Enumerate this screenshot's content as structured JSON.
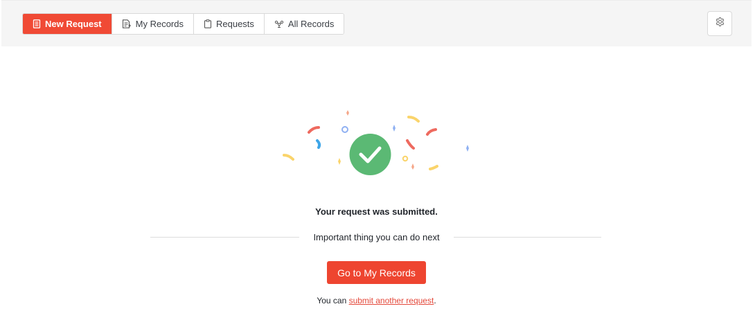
{
  "header": {
    "tabs": [
      {
        "label": "New Request",
        "icon": "form-icon",
        "active": true
      },
      {
        "label": "My Records",
        "icon": "records-icon",
        "active": false
      },
      {
        "label": "Requests",
        "icon": "clipboard-icon",
        "active": false
      },
      {
        "label": "All Records",
        "icon": "org-chart-icon",
        "active": false
      }
    ],
    "settings_icon": "gear-icon"
  },
  "success": {
    "icon": "check-circle-icon",
    "title": "Your request was submitted.",
    "next_label": "Important thing you can do next",
    "primary_button": "Go to My Records",
    "footnote_prefix": "You can ",
    "footnote_link": "submit another request",
    "footnote_suffix": "."
  },
  "colors": {
    "accent": "#ee4530",
    "success": "#5bb974",
    "link": "#e4483a"
  }
}
